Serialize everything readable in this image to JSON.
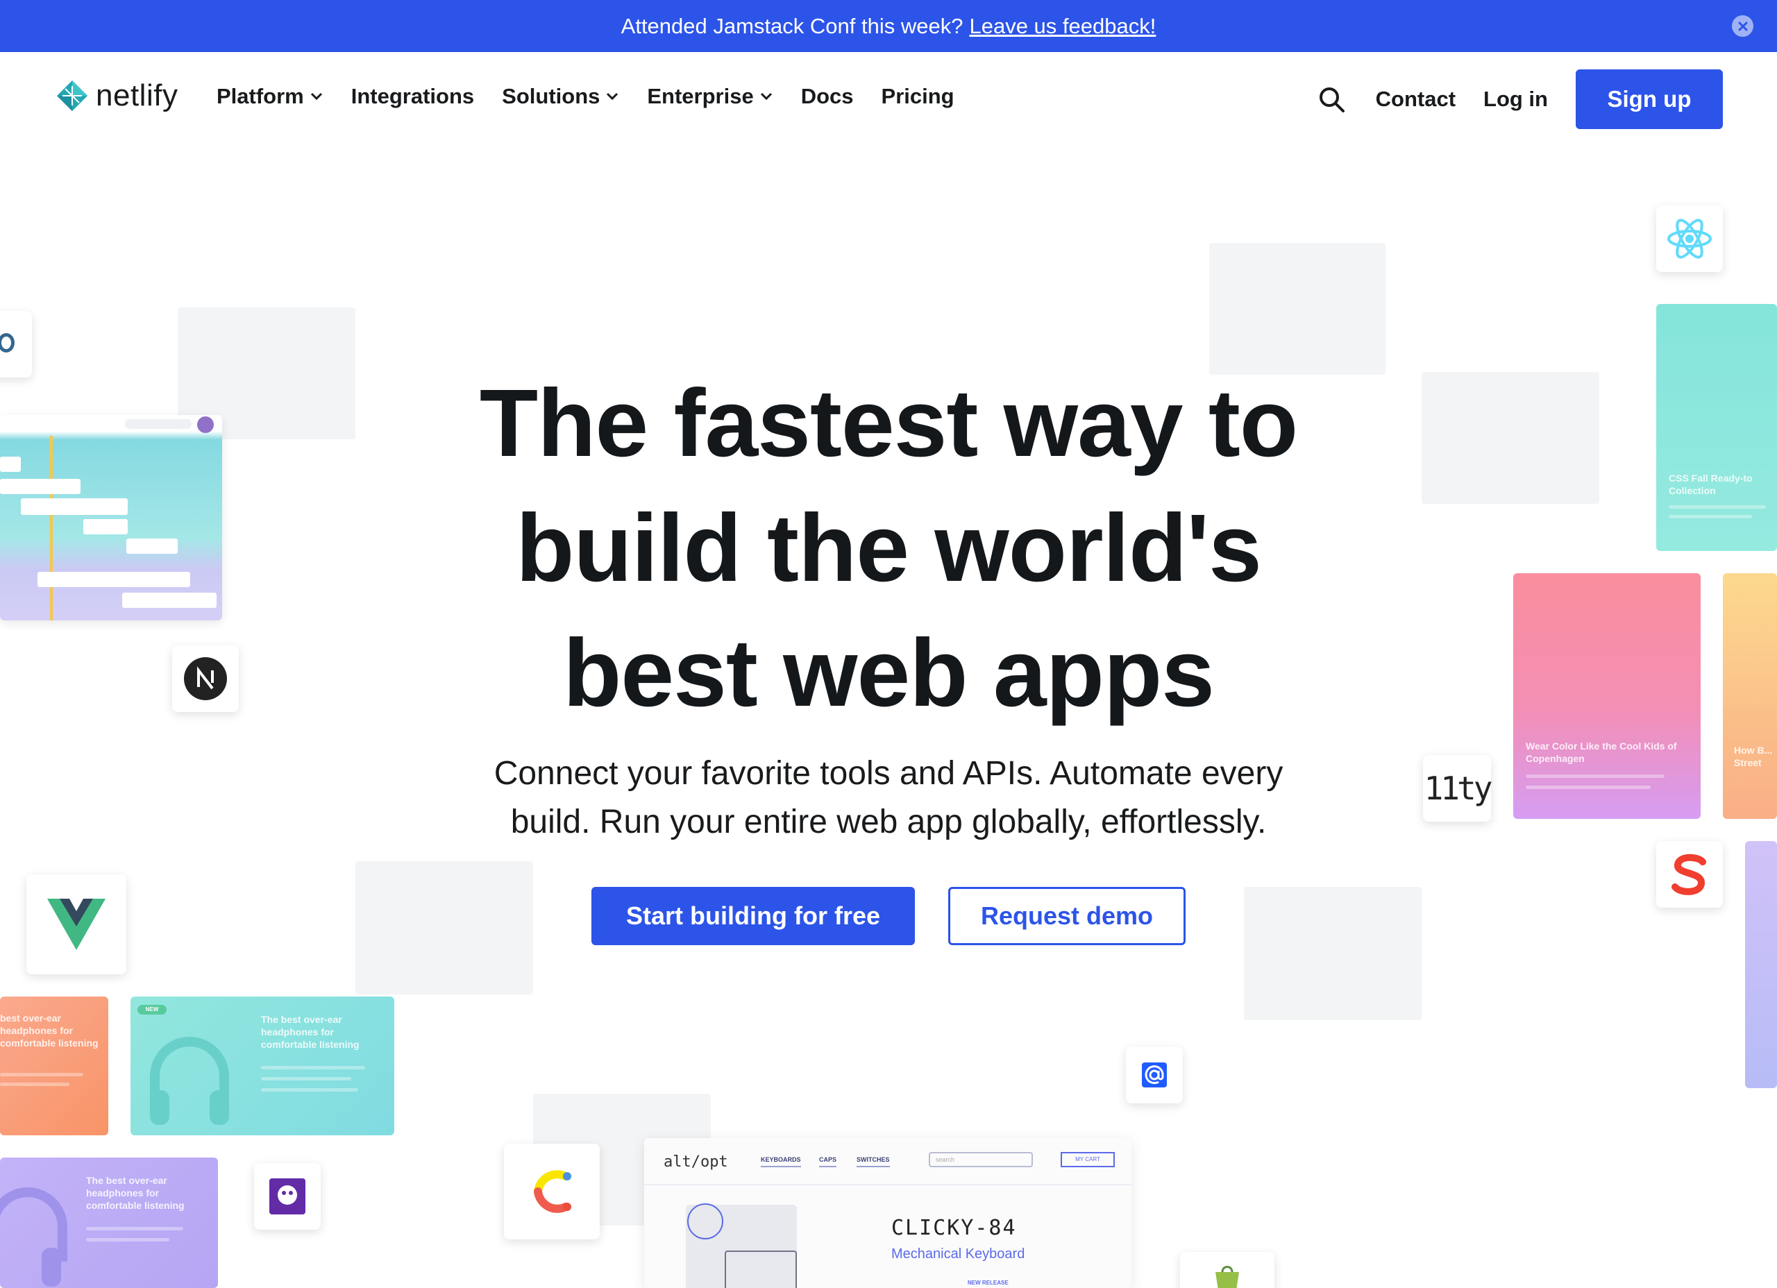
{
  "colors": {
    "accent": "#2c54e8",
    "text": "#15181b",
    "placeholder": "#f2f4f6"
  },
  "banner": {
    "text": "Attended Jamstack Conf this week?",
    "link": "Leave us feedback!",
    "close_icon": "close-icon"
  },
  "nav": {
    "brand": "netlify",
    "items": [
      {
        "label": "Platform",
        "dropdown": true
      },
      {
        "label": "Integrations",
        "dropdown": false
      },
      {
        "label": "Solutions",
        "dropdown": true
      },
      {
        "label": "Enterprise",
        "dropdown": true
      },
      {
        "label": "Docs",
        "dropdown": false
      },
      {
        "label": "Pricing",
        "dropdown": false
      }
    ],
    "contact": "Contact",
    "login": "Log in",
    "signup": "Sign up"
  },
  "hero": {
    "title_line1": "The fastest way to",
    "title_line2": "build the world's",
    "title_line3": "best web apps",
    "subtitle_line1": "Connect your favorite tools and APIs. Automate every",
    "subtitle_line2": "build. Run your entire web app globally, effortlessly.",
    "cta_primary": "Start building for free",
    "cta_secondary": "Request demo"
  },
  "decor": {
    "eleventy": "11ty",
    "card_teal_right": "CSS Fall Ready-to Collection",
    "card_pink": "Wear Color Like the Cool Kids of Copenhagen",
    "card_orange_right": "How B... Street",
    "card_headphones": "The best over-ear headphones for comfortable listening",
    "card_orange_left": "best over-ear headphones for comfortable listening",
    "card_purple_left": "The best over-ear headphones for comfortable listening",
    "card_badge": "NEW"
  },
  "shop": {
    "brand": "alt/opt",
    "nav": [
      "KEYBOARDS",
      "CAPS",
      "SWITCHES"
    ],
    "search_placeholder": "search",
    "cart": "MY CART",
    "product_title": "CLICKY-84",
    "product_subtitle": "Mechanical Keyboard",
    "release_label": "NEW RELEASE"
  }
}
